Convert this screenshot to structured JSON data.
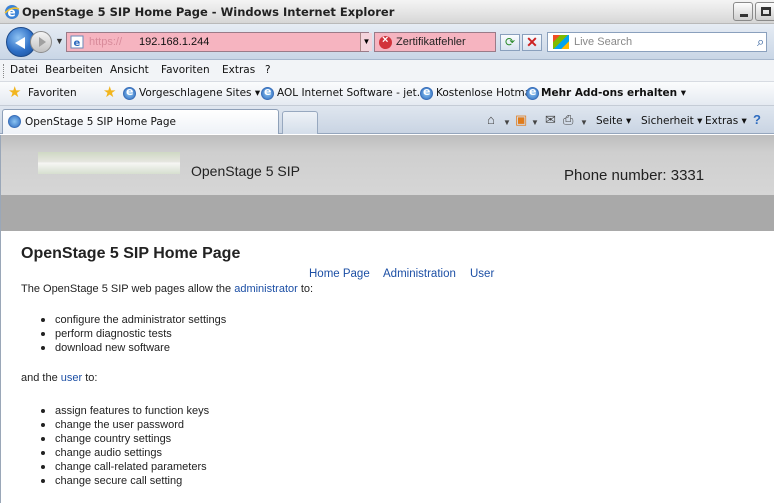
{
  "window": {
    "title": "OpenStage 5 SIP Home Page - Windows Internet Explorer"
  },
  "navbar": {
    "address_protocol": "https://",
    "address_host": "192.168.1.244",
    "certificate_error": "Zertifikatfehler",
    "search_placeholder": "Live Search"
  },
  "menubar": {
    "items": [
      "Datei",
      "Bearbeiten",
      "Ansicht",
      "Favoriten",
      "Extras",
      "?"
    ]
  },
  "favbar": {
    "favorites": "Favoriten",
    "suggested_sites": "Vorgeschlagene Sites ▾",
    "aol": "AOL Internet Software - jet...",
    "hotmail": "Kostenlose Hotmail",
    "addons": "Mehr Add-ons erhalten ▾"
  },
  "tabbar": {
    "tab_label": "OpenStage 5 SIP Home Page",
    "commands": {
      "page": "Seite ▾",
      "safety": "Sicherheit ▾",
      "tools": "Extras ▾"
    }
  },
  "site": {
    "product_name": "OpenStage 5 SIP",
    "phone_number": "Phone number: 3331",
    "nav": [
      "Home Page",
      "Administration",
      "User"
    ],
    "heading": "OpenStage 5 SIP Home Page",
    "intro_before": "The OpenStage 5 SIP web pages allow the ",
    "intro_link": "administrator",
    "intro_after": " to:",
    "admin_items": [
      "configure the administrator settings",
      "perform diagnostic tests",
      "download new software"
    ],
    "user_before": "and the ",
    "user_link": "user",
    "user_after": " to:",
    "user_items": [
      "assign features to function keys",
      "change the user password",
      "change country settings",
      "change audio settings",
      "change call-related parameters",
      "change secure call setting"
    ]
  }
}
